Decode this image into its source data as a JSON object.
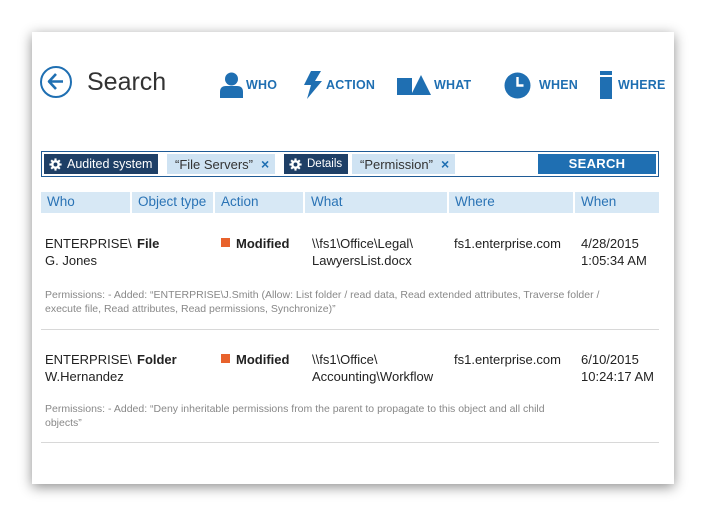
{
  "header": {
    "title": "Search",
    "nav": [
      {
        "label": "WHO",
        "icon": "person-icon"
      },
      {
        "label": "ACTION",
        "icon": "lightning-icon"
      },
      {
        "label": "WHAT",
        "icon": "shapes-icon"
      },
      {
        "label": "WHEN",
        "icon": "clock-icon"
      },
      {
        "label": "WHERE",
        "icon": "server-icon"
      }
    ]
  },
  "search_bar": {
    "filter1": {
      "key": "Audited system",
      "value": "“File Servers”"
    },
    "filter2": {
      "key": "Details",
      "value": "“Permission”"
    },
    "remove_glyph": "×",
    "search_label": "SEARCH"
  },
  "table": {
    "headers": [
      "Who",
      "Object type",
      "Action",
      "What",
      "Where",
      "When"
    ],
    "rows": [
      {
        "who": [
          "ENTERPRISE\\",
          "G. Jones"
        ],
        "object_type": "File",
        "action": "Modified",
        "what": [
          "\\\\fs1\\Office\\Legal\\",
          "LawyersList.docx"
        ],
        "where": "fs1.enterprise.com",
        "when": [
          "4/28/2015",
          "1:05:34 AM"
        ],
        "details": [
          "Permissions: - Added: “ENTERPRISE\\J.Smith (Allow: List folder / read data, Read extended attributes, Traverse folder /",
          "execute file, Read attributes, Read permissions, Synchronize)”"
        ]
      },
      {
        "who": [
          "ENTERPRISE\\",
          "W.Hernandez"
        ],
        "object_type": "Folder",
        "action": "Modified",
        "what": [
          "\\\\fs1\\Office\\",
          "Accounting\\Workflow"
        ],
        "where": "fs1.enterprise.com",
        "when": [
          "6/10/2015",
          "10:24:17 AM"
        ],
        "details": [
          "Permissions: - Added: “Deny inheritable permissions from the parent to propagate to this object and all child",
          "objects”"
        ]
      }
    ]
  },
  "colors": {
    "accent": "#1f6fb2",
    "chip_dark": "#1e3f66",
    "chip_light": "#cfe3f3",
    "header_bg": "#d7e8f5",
    "modified": "#e8622c"
  }
}
